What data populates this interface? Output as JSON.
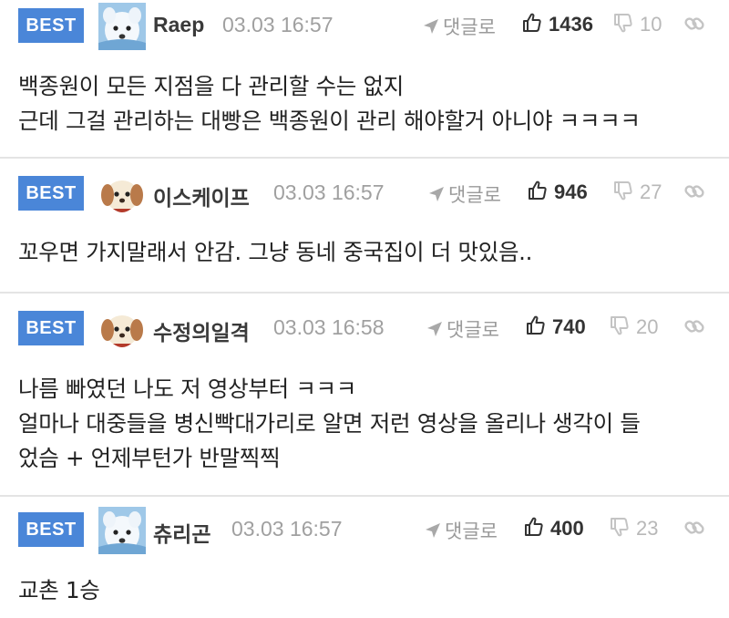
{
  "comments": [
    {
      "badge": "BEST",
      "nick": "Raep",
      "time": "03.03 16:57",
      "reply_label": "댓글로",
      "likes": "1436",
      "dislikes": "10",
      "avatar_icon": "dog-avatar-icon",
      "text": "백종원이 모든 지점을 다 관리할 수는 없지\n근데 그걸 관리하는 대빵은 백종원이 관리 해야할거 아니야 ㅋㅋㅋㅋ"
    },
    {
      "badge": "BEST",
      "nick": "이스케이프",
      "time": "03.03 16:57",
      "reply_label": "댓글로",
      "likes": "946",
      "dislikes": "27",
      "avatar_icon": "puppy-avatar-icon",
      "text": "꼬우면 가지말래서 안감. 그냥 동네 중국집이 더 맛있음.."
    },
    {
      "badge": "BEST",
      "nick": "수정의일격",
      "time": "03.03 16:58",
      "reply_label": "댓글로",
      "likes": "740",
      "dislikes": "20",
      "avatar_icon": "puppy-avatar-icon",
      "text": "나름 빠였던 나도 저 영상부터 ㅋㅋㅋ\n얼마나 대중들을 병신빡대가리로 알면 저런 영상을 올리나 생각이 들\n었슴 + 언제부턴가 반말찍찍"
    },
    {
      "badge": "BEST",
      "nick": "츄리곤",
      "time": "03.03 16:57",
      "reply_label": "댓글로",
      "likes": "400",
      "dislikes": "23",
      "avatar_icon": "dog-avatar-icon",
      "text": "교촌 1승"
    }
  ],
  "colors": {
    "badge_bg": "#4a86d8",
    "divider": "#e4e4e4",
    "muted": "#a0a0a0"
  }
}
